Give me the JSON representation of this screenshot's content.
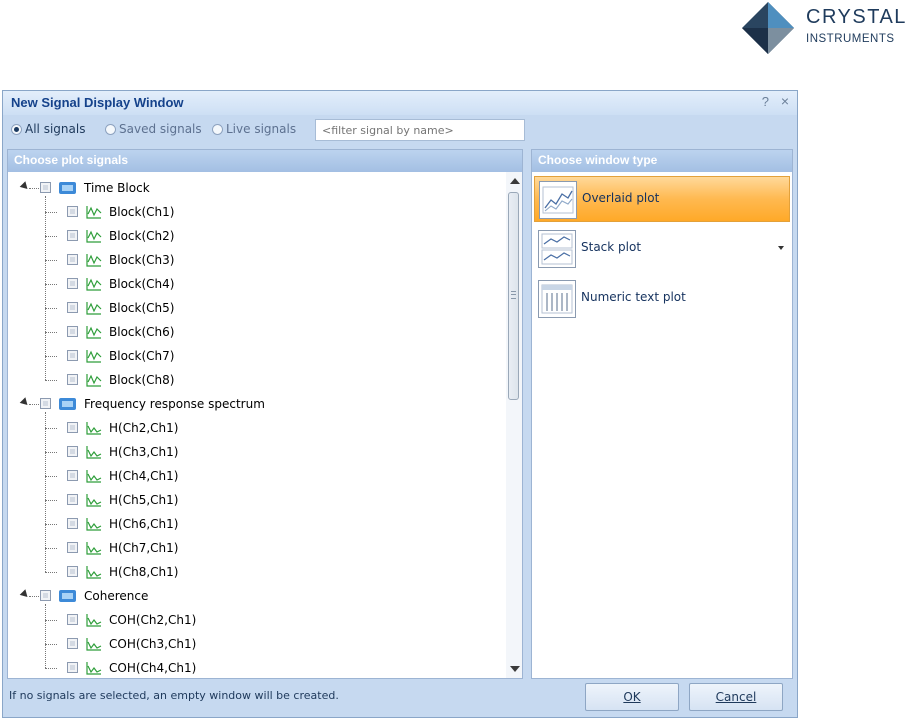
{
  "brand": {
    "line1": "CRYSTAL",
    "line2": "INSTRUMENTS"
  },
  "dialog": {
    "title": "New Signal Display Window",
    "help_glyph": "?",
    "close_glyph": "×"
  },
  "filter": {
    "radios": [
      {
        "label": "All signals",
        "selected": true
      },
      {
        "label": "Saved signals",
        "selected": false
      },
      {
        "label": "Live signals",
        "selected": false
      }
    ],
    "placeholder": "<filter signal by name>"
  },
  "signals_panel": {
    "header": "Choose plot signals",
    "groups": [
      {
        "label": "Time Block",
        "items": [
          "Block(Ch1)",
          "Block(Ch2)",
          "Block(Ch3)",
          "Block(Ch4)",
          "Block(Ch5)",
          "Block(Ch6)",
          "Block(Ch7)",
          "Block(Ch8)"
        ]
      },
      {
        "label": "Frequency response spectrum",
        "items": [
          "H(Ch2,Ch1)",
          "H(Ch3,Ch1)",
          "H(Ch4,Ch1)",
          "H(Ch5,Ch1)",
          "H(Ch6,Ch1)",
          "H(Ch7,Ch1)",
          "H(Ch8,Ch1)"
        ]
      },
      {
        "label": "Coherence",
        "items": [
          "COH(Ch2,Ch1)",
          "COH(Ch3,Ch1)",
          "COH(Ch4,Ch1)"
        ]
      }
    ]
  },
  "window_panel": {
    "header": "Choose window type",
    "types": [
      {
        "label": "Overlaid plot",
        "icon": "overlaid-plot-icon",
        "selected": true
      },
      {
        "label": "Stack plot",
        "icon": "stack-plot-icon",
        "selected": false
      },
      {
        "label": "Numeric text plot",
        "icon": "numeric-text-plot-icon",
        "selected": false
      }
    ]
  },
  "status_text": "If no signals are selected, an empty window will be created.",
  "buttons": {
    "ok": "OK",
    "cancel": "Cancel"
  },
  "colors": {
    "accent": "#ffb950",
    "title": "#15428b",
    "frame": "#c6d9f0"
  }
}
